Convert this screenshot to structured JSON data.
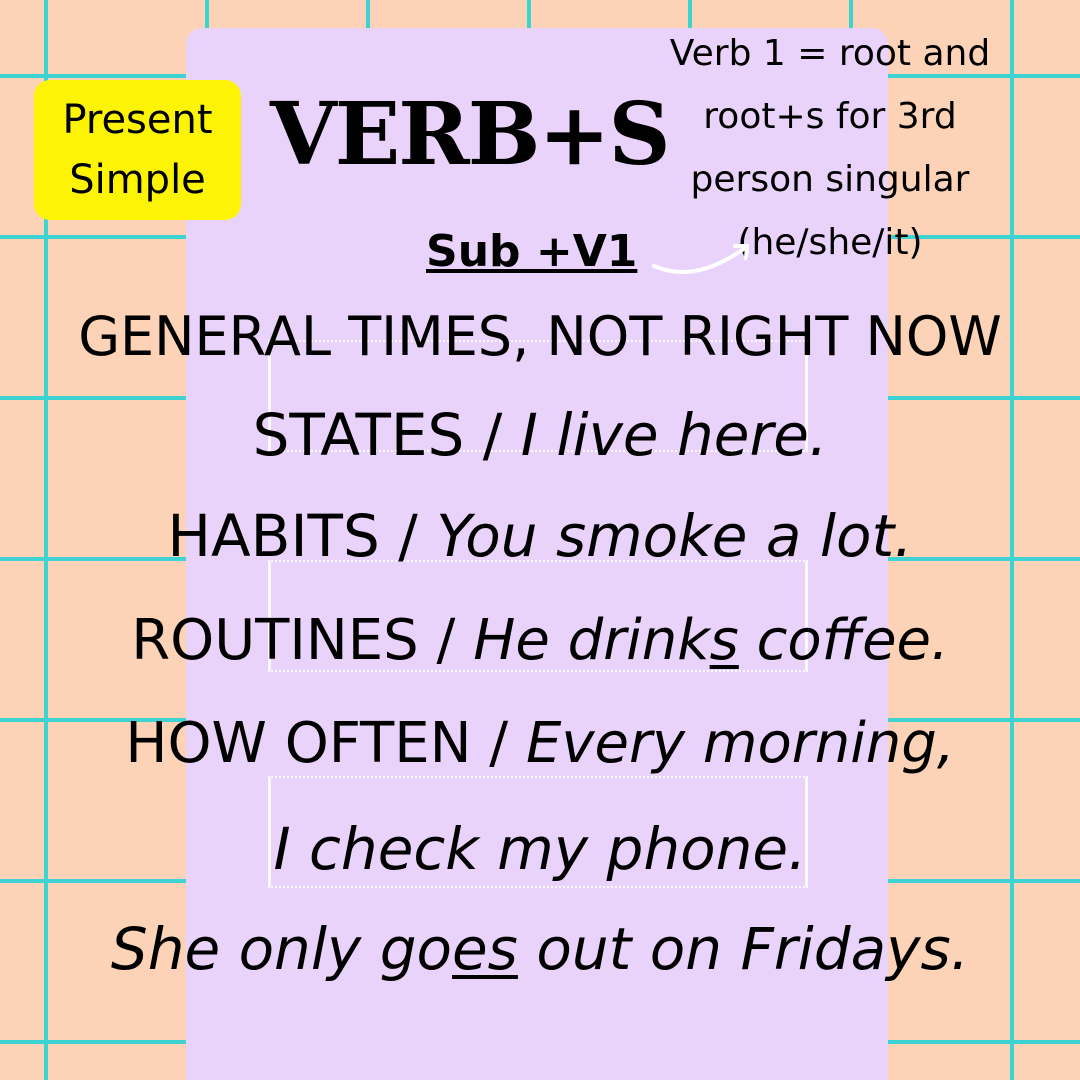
{
  "badge": {
    "line1": "Present",
    "line2": "Simple"
  },
  "title": "VERB+S",
  "note": "Verb 1 = root and root+s for 3rd person singular (he/she/it)",
  "formula": "Sub +V1",
  "lines": {
    "l1": {
      "label": "GENERAL TIMES, NOT RIGHT NOW"
    },
    "l2": {
      "label": "STATES / ",
      "example": "I live here."
    },
    "l3": {
      "label": "HABITS / ",
      "example": "You smoke a lot."
    },
    "l4": {
      "label": "ROUTINES / ",
      "ex_a": "He drink",
      "ex_u": "s",
      "ex_b": " coffee."
    },
    "l5": {
      "label": "HOW OFTEN / ",
      "example": "Every morning,"
    },
    "l6": {
      "example": "I check my phone."
    },
    "l7": {
      "ex_a": "She only go",
      "ex_u": "es",
      "ex_b": " out on Fridays."
    }
  },
  "colors": {
    "background": "#fdd3b8",
    "grid": "#3ed3d3",
    "card": "#ead3fa",
    "badge": "#fdf304"
  }
}
